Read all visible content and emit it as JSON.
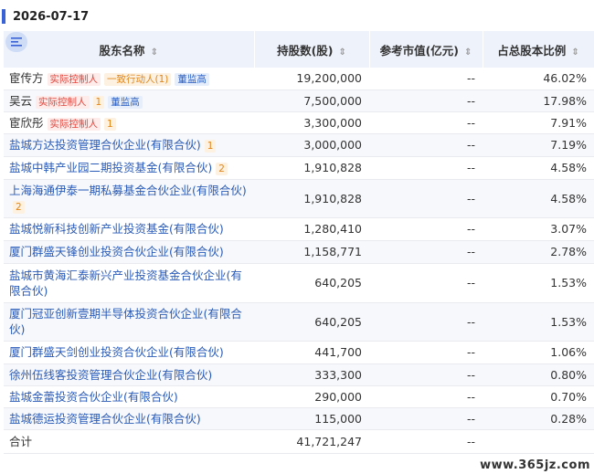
{
  "date": "2026-07-17",
  "columns": {
    "holder": "股东名称",
    "shares": "持股数(股)",
    "market_value": "参考市值(亿元)",
    "ratio": "占总股本比例"
  },
  "rows": [
    {
      "name": "宦传方",
      "plain": true,
      "tags": [
        {
          "text": "实际控制人",
          "color": "red"
        },
        {
          "text": "一致行动人(1)",
          "color": "orange"
        },
        {
          "text": "董监高",
          "color": "blue"
        }
      ],
      "shares": "19,200,000",
      "value": "--",
      "ratio": "46.02%"
    },
    {
      "name": "吴云",
      "plain": true,
      "tags": [
        {
          "text": "实际控制人",
          "color": "red"
        },
        {
          "text": "1",
          "color": "orange"
        },
        {
          "text": "董监高",
          "color": "blue"
        }
      ],
      "shares": "7,500,000",
      "value": "--",
      "ratio": "17.98%"
    },
    {
      "name": "宦欣彤",
      "plain": true,
      "tags": [
        {
          "text": "实际控制人",
          "color": "red"
        },
        {
          "text": "1",
          "color": "orange"
        }
      ],
      "shares": "3,300,000",
      "value": "--",
      "ratio": "7.91%"
    },
    {
      "name": "盐城方达投资管理合伙企业(有限合伙)",
      "plain": false,
      "tags": [
        {
          "text": "1",
          "color": "orange"
        }
      ],
      "shares": "3,000,000",
      "value": "--",
      "ratio": "7.19%"
    },
    {
      "name": "盐城中韩产业园二期投资基金(有限合伙)",
      "plain": false,
      "tags": [
        {
          "text": "2",
          "color": "orange"
        }
      ],
      "shares": "1,910,828",
      "value": "--",
      "ratio": "4.58%"
    },
    {
      "name": "上海海通伊泰一期私募基金合伙企业(有限合伙)",
      "plain": false,
      "tags": [
        {
          "text": "2",
          "color": "orange"
        }
      ],
      "shares": "1,910,828",
      "value": "--",
      "ratio": "4.58%"
    },
    {
      "name": "盐城悦新科技创新产业投资基金(有限合伙)",
      "plain": false,
      "tags": [],
      "shares": "1,280,410",
      "value": "--",
      "ratio": "3.07%"
    },
    {
      "name": "厦门群盛天锋创业投资合伙企业(有限合伙)",
      "plain": false,
      "tags": [],
      "shares": "1,158,771",
      "value": "--",
      "ratio": "2.78%"
    },
    {
      "name": "盐城市黄海汇泰新兴产业投资基金合伙企业(有限合伙)",
      "plain": false,
      "tags": [],
      "shares": "640,205",
      "value": "--",
      "ratio": "1.53%"
    },
    {
      "name": "厦门冠亚创新壹期半导体投资合伙企业(有限合伙)",
      "plain": false,
      "tags": [],
      "shares": "640,205",
      "value": "--",
      "ratio": "1.53%"
    },
    {
      "name": "厦门群盛天剑创业投资合伙企业(有限合伙)",
      "plain": false,
      "tags": [],
      "shares": "441,700",
      "value": "--",
      "ratio": "1.06%"
    },
    {
      "name": "徐州伍线客投资管理合伙企业(有限合伙)",
      "plain": false,
      "tags": [],
      "shares": "333,300",
      "value": "--",
      "ratio": "0.80%"
    },
    {
      "name": "盐城金蕾投资合伙企业(有限合伙)",
      "plain": false,
      "tags": [],
      "shares": "290,000",
      "value": "--",
      "ratio": "0.70%"
    },
    {
      "name": "盐城德运投资管理合伙企业(有限合伙)",
      "plain": false,
      "tags": [],
      "shares": "115,000",
      "value": "--",
      "ratio": "0.28%"
    }
  ],
  "total": {
    "label": "合计",
    "shares": "41,721,247",
    "value": "--",
    "ratio": ""
  },
  "watermark": "www.365jz.com",
  "icons": {
    "sort": "sort-icon",
    "menu": "menu-toggle-icon"
  }
}
